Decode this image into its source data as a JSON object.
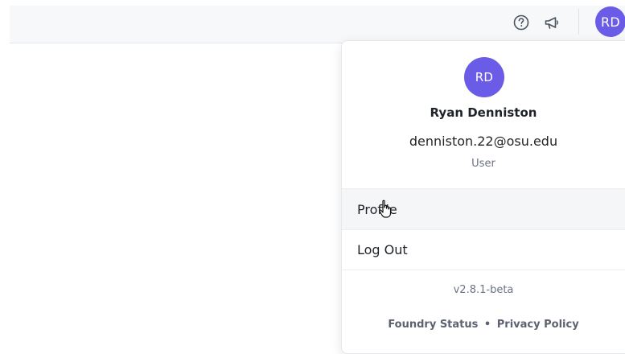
{
  "topbar": {
    "help_icon": "help-circle-icon",
    "announcement_icon": "megaphone-icon",
    "avatar_initials": "RD",
    "avatar_color": "#6b5ce7"
  },
  "user_menu": {
    "avatar_initials": "RD",
    "name": "Ryan Denniston",
    "email": "denniston.22@osu.edu",
    "role": "User",
    "items": [
      {
        "label": "Profile"
      },
      {
        "label": "Log Out"
      }
    ],
    "version": "v2.8.1-beta",
    "footer": {
      "status_link": "Foundry Status",
      "separator": "•",
      "privacy_link": "Privacy Policy"
    }
  }
}
